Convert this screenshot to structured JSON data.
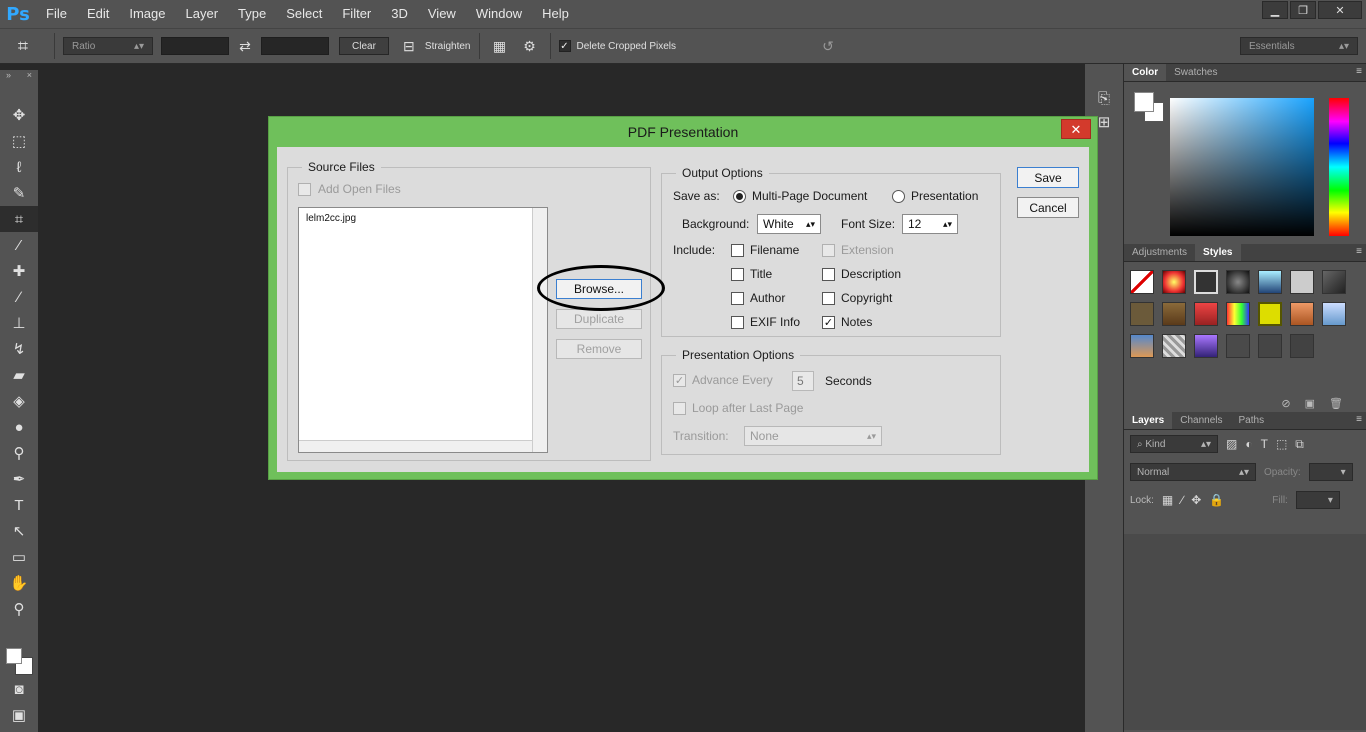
{
  "app": {
    "logo": "Ps"
  },
  "menu": [
    "File",
    "Edit",
    "Image",
    "Layer",
    "Type",
    "Select",
    "Filter",
    "3D",
    "View",
    "Window",
    "Help"
  ],
  "window_controls": {
    "minimize": "▁",
    "restore": "❐",
    "close": "✕"
  },
  "options_bar": {
    "ratio": "Ratio",
    "clear": "Clear",
    "straighten": "Straighten",
    "delete_cropped": "Delete Cropped Pixels",
    "workspace": "Essentials"
  },
  "panels": {
    "color_tabs": [
      "Color",
      "Swatches"
    ],
    "adjust_tabs": [
      "Adjustments",
      "Styles"
    ],
    "layers_tabs": [
      "Layers",
      "Channels",
      "Paths"
    ],
    "kind": "Kind",
    "blend_mode": "Normal",
    "opacity_label": "Opacity:",
    "lock_label": "Lock:",
    "fill_label": "Fill:"
  },
  "dialog": {
    "title": "PDF Presentation",
    "close": "✕",
    "source_files": {
      "legend": "Source Files",
      "add_open_files": "Add Open Files",
      "files": [
        "lelm2cc.jpg"
      ],
      "browse": "Browse...",
      "duplicate": "Duplicate",
      "remove": "Remove"
    },
    "output": {
      "legend": "Output Options",
      "save_as_label": "Save as:",
      "multi_page": "Multi-Page Document",
      "presentation": "Presentation",
      "background_label": "Background:",
      "background_value": "White",
      "font_size_label": "Font Size:",
      "font_size_value": "12",
      "include_label": "Include:",
      "filename": "Filename",
      "extension": "Extension",
      "title": "Title",
      "description": "Description",
      "author": "Author",
      "copyright": "Copyright",
      "exif": "EXIF Info",
      "notes": "Notes"
    },
    "presentation": {
      "legend": "Presentation Options",
      "advance_every": "Advance Every",
      "advance_value": "5",
      "seconds": "Seconds",
      "loop": "Loop after Last Page",
      "transition_label": "Transition:",
      "transition_value": "None"
    },
    "save": "Save",
    "cancel": "Cancel"
  },
  "colors": {
    "dialog_frame": "#6fc05b",
    "dialog_body": "#dcdcdc",
    "workspace_bg": "#282828",
    "chrome": "#535353",
    "close_red": "#d33a2c"
  }
}
